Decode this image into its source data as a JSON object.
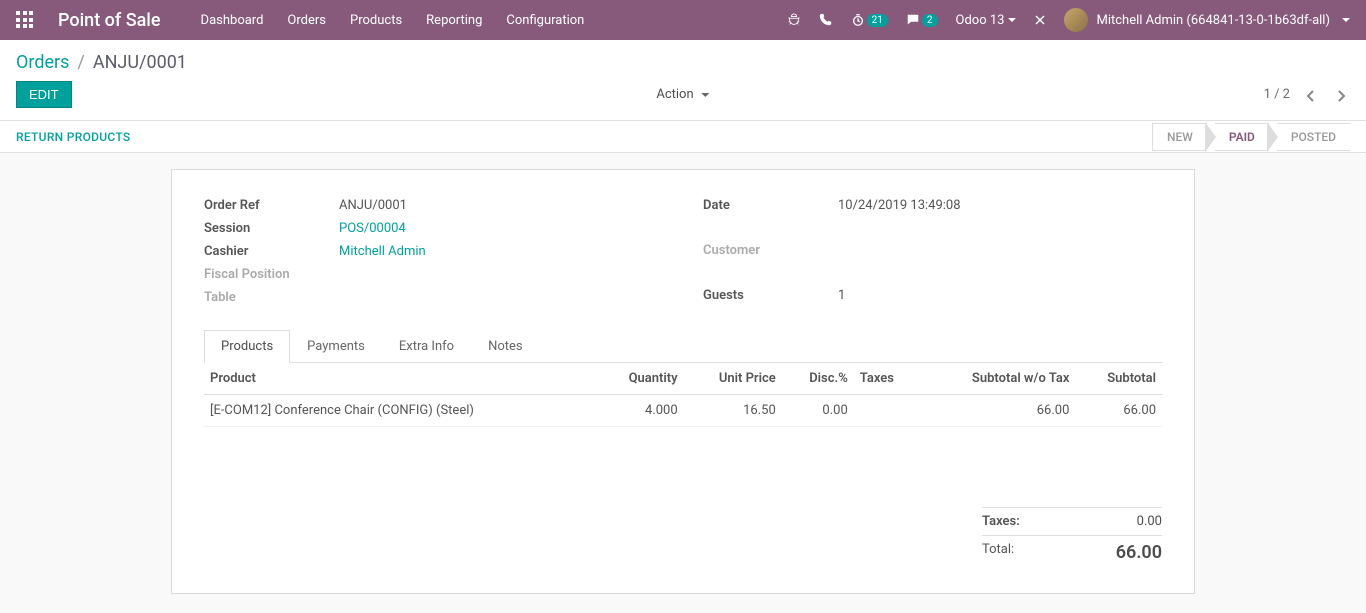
{
  "navbar": {
    "brand": "Point of Sale",
    "menu": [
      "Dashboard",
      "Orders",
      "Products",
      "Reporting",
      "Configuration"
    ],
    "timer_badge": "21",
    "chat_badge": "2",
    "db_label": "Odoo 13",
    "user_label": "Mitchell Admin (664841-13-0-1b63df-all)"
  },
  "breadcrumb": {
    "root": "Orders",
    "current": "ANJU/0001"
  },
  "buttons": {
    "edit": "EDIT",
    "action": "Action",
    "return_products": "RETURN PRODUCTS"
  },
  "pager": {
    "label": "1 / 2"
  },
  "status": {
    "new": "NEW",
    "paid": "PAID",
    "posted": "POSTED"
  },
  "order": {
    "ref_label": "Order Ref",
    "ref_value": "ANJU/0001",
    "session_label": "Session",
    "session_value": "POS/00004",
    "cashier_label": "Cashier",
    "cashier_value": "Mitchell Admin",
    "fiscal_label": "Fiscal Position",
    "table_label": "Table",
    "date_label": "Date",
    "date_value": "10/24/2019 13:49:08",
    "customer_label": "Customer",
    "guests_label": "Guests",
    "guests_value": "1"
  },
  "tabs": {
    "products": "Products",
    "payments": "Payments",
    "extra": "Extra Info",
    "notes": "Notes"
  },
  "table": {
    "headers": {
      "product": "Product",
      "quantity": "Quantity",
      "unit_price": "Unit Price",
      "disc": "Disc.%",
      "taxes": "Taxes",
      "subtotal_wo": "Subtotal w/o Tax",
      "subtotal": "Subtotal"
    },
    "rows": [
      {
        "product": "[E-COM12] Conference Chair (CONFIG) (Steel)",
        "quantity": "4.000",
        "unit_price": "16.50",
        "disc": "0.00",
        "taxes": "",
        "subtotal_wo": "66.00",
        "subtotal": "66.00"
      }
    ]
  },
  "totals": {
    "taxes_label": "Taxes:",
    "taxes_value": "0.00",
    "total_label": "Total:",
    "total_value": "66.00"
  }
}
